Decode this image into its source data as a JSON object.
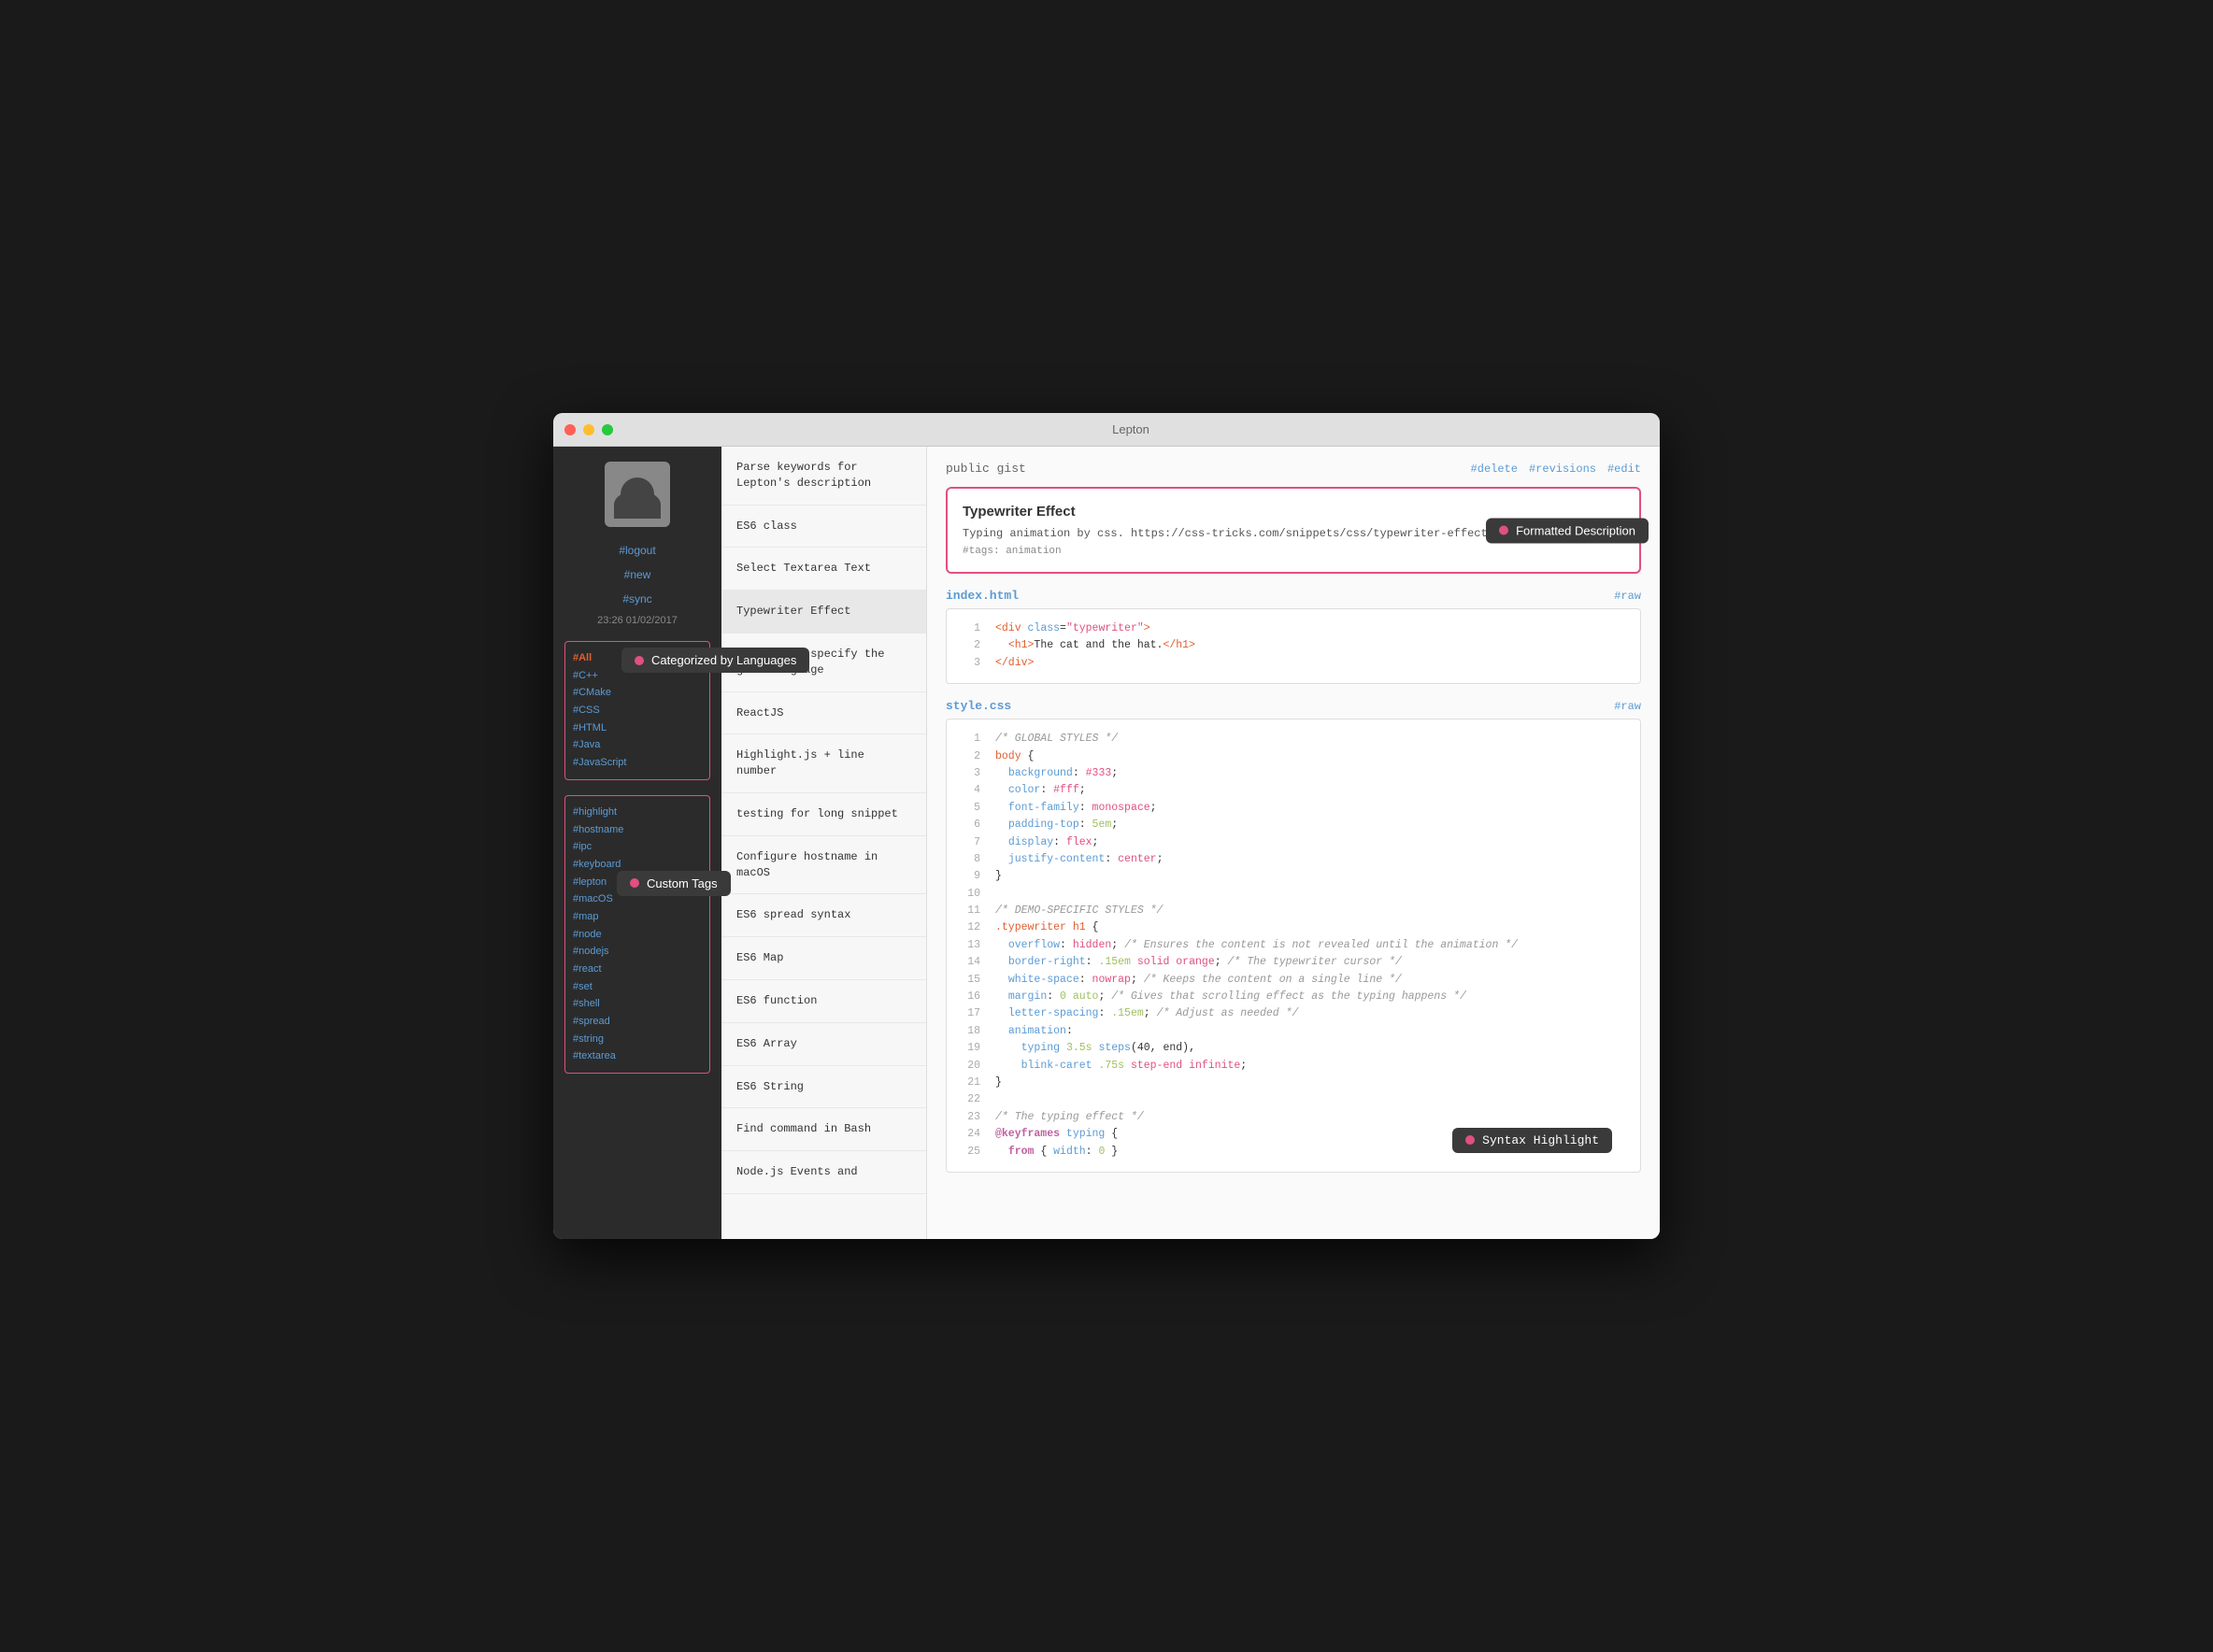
{
  "window": {
    "title": "Lepton"
  },
  "sidebar": {
    "logout_label": "#logout",
    "new_label": "#new",
    "sync_label": "#sync",
    "meta": "23:26 01/02/2017",
    "languages_section": {
      "tooltip_label": "Categorized by Languages",
      "items": [
        {
          "label": "#All",
          "active": true
        },
        {
          "label": "#C++",
          "active": false
        },
        {
          "label": "#CMake",
          "active": false
        },
        {
          "label": "#CSS",
          "active": false
        },
        {
          "label": "#HTML",
          "active": false
        },
        {
          "label": "#Java",
          "active": false
        },
        {
          "label": "#JavaScript",
          "active": false
        }
      ]
    },
    "tags_section": {
      "tooltip_label": "Custom Tags",
      "items": [
        {
          "label": "#highlight"
        },
        {
          "label": "#hostname"
        },
        {
          "label": "#ipc"
        },
        {
          "label": "#keyboard"
        },
        {
          "label": "#lepton"
        },
        {
          "label": "#macOS"
        },
        {
          "label": "#map"
        },
        {
          "label": "#node"
        },
        {
          "label": "#nodejs"
        },
        {
          "label": "#react"
        },
        {
          "label": "#set"
        },
        {
          "label": "#shell"
        },
        {
          "label": "#spread"
        },
        {
          "label": "#string"
        },
        {
          "label": "#textarea"
        }
      ]
    }
  },
  "snippet_list": {
    "items": [
      {
        "label": "Parse keywords for\nLepton's description",
        "active": false
      },
      {
        "label": "ES6 class",
        "active": false
      },
      {
        "label": "Select Textarea Text",
        "active": false
      },
      {
        "label": "Typewriter Effect",
        "active": true
      },
      {
        "label": "Example to specify the\ngist language",
        "active": false
      },
      {
        "label": "ReactJS",
        "active": false
      },
      {
        "label": "Highlight.js + line\nnumber",
        "active": false
      },
      {
        "label": "testing for long snippet",
        "active": false
      },
      {
        "label": "Configure hostname in\nmacOS",
        "active": false
      },
      {
        "label": "ES6 spread syntax",
        "active": false
      },
      {
        "label": "ES6 Map",
        "active": false
      },
      {
        "label": "ES6 function",
        "active": false
      },
      {
        "label": "ES6 Array",
        "active": false
      },
      {
        "label": "ES6 String",
        "active": false
      },
      {
        "label": "Find command in Bash",
        "active": false
      },
      {
        "label": "Node.js Events and",
        "active": false
      }
    ]
  },
  "main": {
    "gist_label": "public gist",
    "actions": {
      "delete": "#delete",
      "revisions": "#revisions",
      "edit": "#edit"
    },
    "description": {
      "title": "Typewriter Effect",
      "text": "Typing animation by css. https://css-tricks.com/snippets/css/typewriter-effect/",
      "tag": "#tags: animation",
      "tooltip": "Formatted Description"
    },
    "files": [
      {
        "name": "index.html",
        "raw": "#raw",
        "lines": [
          {
            "num": 1,
            "content": "<div class=\"typewriter\">"
          },
          {
            "num": 2,
            "content": "  <h1>The cat and the hat.</h1>"
          },
          {
            "num": 3,
            "content": "</div>"
          }
        ]
      },
      {
        "name": "style.css",
        "raw": "#raw",
        "tooltip": "Syntax Highlight",
        "lines": [
          {
            "num": 1,
            "content": "/* GLOBAL STYLES */"
          },
          {
            "num": 2,
            "content": "body {"
          },
          {
            "num": 3,
            "content": "  background: #333;"
          },
          {
            "num": 4,
            "content": "  color: #fff;"
          },
          {
            "num": 5,
            "content": "  font-family: monospace;"
          },
          {
            "num": 6,
            "content": "  padding-top: 5em;"
          },
          {
            "num": 7,
            "content": "  display: flex;"
          },
          {
            "num": 8,
            "content": "  justify-content: center;"
          },
          {
            "num": 9,
            "content": "}"
          },
          {
            "num": 10,
            "content": ""
          },
          {
            "num": 11,
            "content": "/* DEMO-SPECIFIC STYLES */"
          },
          {
            "num": 12,
            "content": ".typewriter h1 {"
          },
          {
            "num": 13,
            "content": "  overflow: hidden; /* Ensures the content is not revealed until the animation */"
          },
          {
            "num": 14,
            "content": "  border-right: .15em solid orange; /* The typewriter cursor */"
          },
          {
            "num": 15,
            "content": "  white-space: nowrap; /* Keeps the content on a single line */"
          },
          {
            "num": 16,
            "content": "  margin: 0 auto; /* Gives that scrolling effect as the typing happens */"
          },
          {
            "num": 17,
            "content": "  letter-spacing: .15em; /* Adjust as needed */"
          },
          {
            "num": 18,
            "content": "  animation:"
          },
          {
            "num": 19,
            "content": "    typing 3.5s steps(40, end),"
          },
          {
            "num": 20,
            "content": "    blink-caret .75s step-end infinite;"
          },
          {
            "num": 21,
            "content": "}"
          },
          {
            "num": 22,
            "content": ""
          },
          {
            "num": 23,
            "content": "/* The typing effect */"
          },
          {
            "num": 24,
            "content": "@keyframes typing {"
          },
          {
            "num": 25,
            "content": "  from { width: 0 }"
          }
        ]
      }
    ]
  }
}
